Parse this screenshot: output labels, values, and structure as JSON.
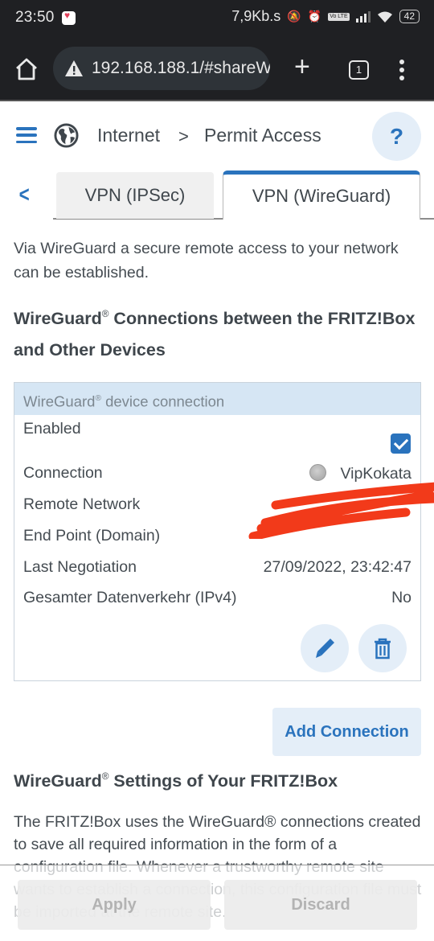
{
  "status_bar": {
    "time": "23:50",
    "net_speed": "7,9Kb.s",
    "battery": "42",
    "volte": "Vo LTE"
  },
  "browser": {
    "url": "192.168.188.1/#shareW",
    "tab_count": "1"
  },
  "header": {
    "breadcrumb": [
      "Internet",
      "Permit Access"
    ],
    "breadcrumb_separator": ">",
    "help_label": "?"
  },
  "tabs": [
    {
      "label": "VPN (IPSec)",
      "active": false
    },
    {
      "label": "VPN (WireGuard)",
      "active": true
    }
  ],
  "intro_text": "Via WireGuard a secure remote access to your network can be established.",
  "connections_heading": "WireGuard",
  "connections_heading_rest": " Connections between the FRITZ!Box and Other Devices",
  "registered_mark": "®",
  "connection_table": {
    "header": "WireGuard",
    "header_rest": " device connection",
    "rows": [
      {
        "label": "Enabled",
        "value": "",
        "checked": true
      },
      {
        "label": "Connection",
        "value": "VipKokata",
        "status": "inactive"
      },
      {
        "label": "Remote Network",
        "value": "",
        "redacted": true
      },
      {
        "label": "End Point (Domain)",
        "value": ""
      },
      {
        "label": "Last Negotiation",
        "value": "27/09/2022, 23:42:47"
      },
      {
        "label": "Gesamter Datenverkehr (IPv4)",
        "value": "No"
      }
    ]
  },
  "add_connection_label": "Add Connection",
  "settings_heading": "WireGuard",
  "settings_heading_rest": " Settings of Your FRITZ!Box",
  "settings_text": "The FRITZ!Box uses the WireGuard® connections created to save all required information in the form of a configuration file. Whenever a trustworthy remote site wants to establish a connection, this configuration file must be imported at the remote site.",
  "footer": {
    "apply_label": "Apply",
    "discard_label": "Discard"
  },
  "colors": {
    "accent": "#2a73bd",
    "accent_light": "#e4eef8",
    "table_header_bg": "#d6e6f4",
    "redaction": "#f23a1a"
  }
}
